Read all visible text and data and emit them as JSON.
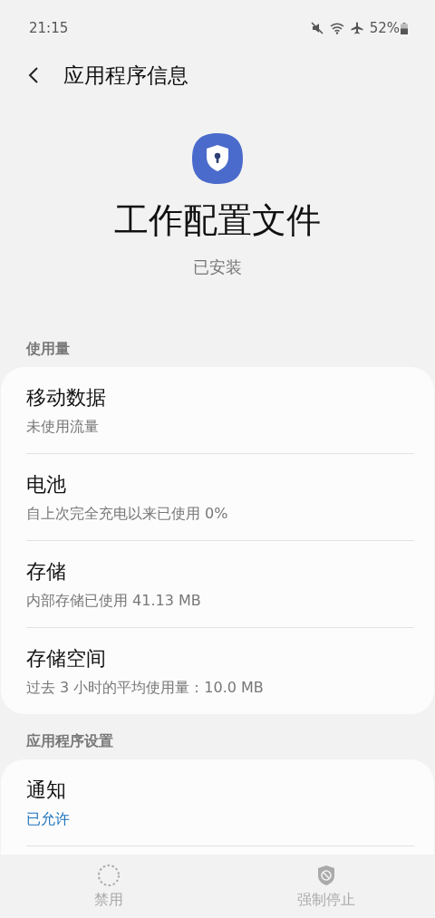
{
  "status_bar": {
    "time": "21:15",
    "battery": "52%"
  },
  "header": {
    "title": "应用程序信息"
  },
  "app": {
    "name": "工作配置文件",
    "status": "已安装"
  },
  "sections": [
    {
      "title": "使用量",
      "items": [
        {
          "title": "移动数据",
          "summary": "未使用流量",
          "highlighted": false
        },
        {
          "title": "电池",
          "summary": "自上次完全充电以来已使用 0%",
          "highlighted": false
        },
        {
          "title": "存储",
          "summary": "内部存储已使用 41.13 MB",
          "highlighted": false
        },
        {
          "title": "存储空间",
          "summary": "过去 3 小时的平均使用量：10.0 MB",
          "highlighted": false
        }
      ]
    },
    {
      "title": "应用程序设置",
      "items": [
        {
          "title": "通知",
          "summary": "已允许",
          "highlighted": true
        }
      ]
    }
  ],
  "bottom_actions": [
    {
      "kind": "disable",
      "label": "禁用",
      "disabled": true
    },
    {
      "kind": "stop",
      "label": "强制停止",
      "disabled": true
    }
  ]
}
